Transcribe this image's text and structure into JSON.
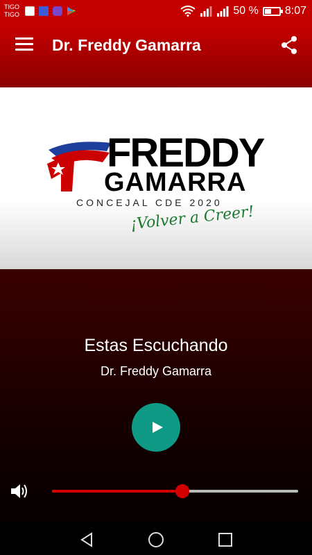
{
  "status_bar": {
    "carriers": [
      "TIGO",
      "TIGO"
    ],
    "battery_text": "50 %",
    "time": "8:07",
    "battery_level": 0.5,
    "notification_icons": [
      "tigo-app-icon",
      "phone-manager-icon",
      "messaging-icon",
      "play-store-icon"
    ]
  },
  "app_bar": {
    "title": "Dr. Freddy Gamarra"
  },
  "banner": {
    "logo_name_first": "FREDDY",
    "logo_name_last": "GAMARRA",
    "logo_subtitle": "CONCEJAL CDE 2020",
    "logo_slogan": "¡Volver a Creer!"
  },
  "player": {
    "now_playing_label": "Estas Escuchando",
    "station_name": "Dr. Freddy Gamarra",
    "volume_level": 0.53
  },
  "colors": {
    "accent_red": "#c40000",
    "play_teal": "#0f9a86",
    "slogan_green": "#1a7a2e"
  }
}
